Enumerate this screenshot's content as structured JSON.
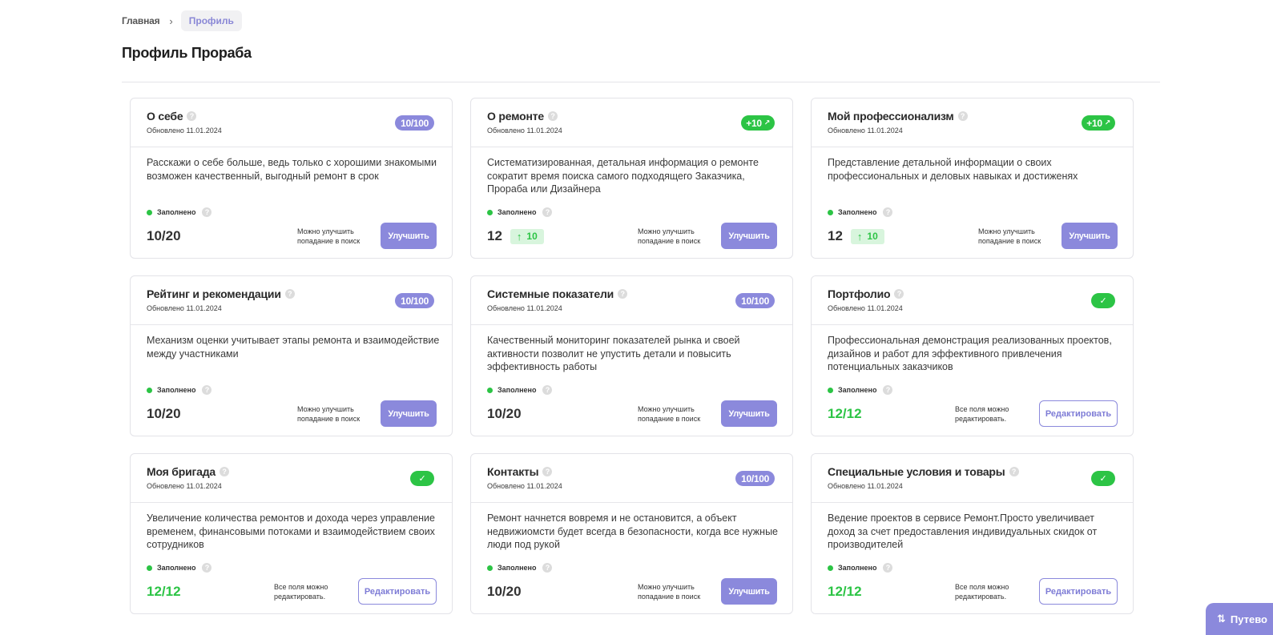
{
  "breadcrumb": {
    "home": "Главная",
    "separator": "›",
    "current": "Профиль"
  },
  "page": {
    "title": "Профиль Прораба"
  },
  "colors": {
    "accent": "#8b89dc",
    "success": "#2cc445",
    "success_bg": "#d8f5dd"
  },
  "cards": [
    {
      "title": "О себе",
      "updated": "Обновлено 11.01.2024",
      "badge": "10/100",
      "description": "Расскажи о себе больше, ведь только с хорошими знакомыми возможен качественный, выгодный ремонт в срок",
      "status": "Заполнено",
      "score": "10/20",
      "hint": "Можно улучшить попадание в поиск",
      "button": "Улучшить"
    },
    {
      "title": "О ремонте",
      "updated": "Обновлено 11.01.2024",
      "badge": "+10",
      "description": "Систематизированная, детальная информация о ремонте сократит время поиска самого подходящего Заказчика, Прораба или Дизайнера",
      "status": "Заполнено",
      "score": "12",
      "growth": "10",
      "hint": "Можно улучшить попадание в поиск",
      "button": "Улучшить"
    },
    {
      "title": "Мой профессионализм",
      "updated": "Обновлено 11.01.2024",
      "badge": "+10",
      "description": "Представление детальной информации о своих профессиональных и деловых навыках и достиженях",
      "status": "Заполнено",
      "score": "12",
      "growth": "10",
      "hint": "Можно улучшить попадание в поиск",
      "button": "Улучшить"
    },
    {
      "title": "Рейтинг и рекомендации",
      "updated": "Обновлено 11.01.2024",
      "badge": "10/100",
      "description": "Механизм оценки учитывает этапы ремонта и взаимодействие между участниками",
      "status": "Заполнено",
      "score": "10/20",
      "hint": "Можно улучшить попадание в поиск",
      "button": "Улучшить"
    },
    {
      "title": "Системные показатели",
      "updated": "Обновлено 11.01.2024",
      "badge": "10/100",
      "description": "Качественный мониторинг показателей рынка и своей активности позволит не упустить детали и повысить эффективность работы",
      "status": "Заполнено",
      "score": "10/20",
      "hint": "Можно улучшить попадание в поиск",
      "button": "Улучшить"
    },
    {
      "title": "Портфолио",
      "updated": "Обновлено 11.01.2024",
      "badge": "✓",
      "description": "Профессиональная демонстрация реализованных проектов, дизайнов и работ для эффективного привлечения потенциальных заказчиков",
      "status": "Заполнено",
      "score": "12/12",
      "hint": "Все поля можно редактировать.",
      "button": "Редактировать"
    },
    {
      "title": "Моя бригада",
      "updated": "Обновлено 11.01.2024",
      "badge": "✓",
      "description": "Увеличение количества ремонтов и дохода через управление временем, финансовыми потоками и взаимодействием своих сотрудников",
      "status": "Заполнено",
      "score": "12/12",
      "hint": "Все поля можно редактировать.",
      "button": "Редактировать"
    },
    {
      "title": "Контакты",
      "updated": "Обновлено 11.01.2024",
      "badge": "10/100",
      "description": "Ремонт начнется вовремя и не остановится, а объект недвижиомсти будет всегда в безопасности, когда все нужные люди под рукой",
      "status": "Заполнено",
      "score": "10/20",
      "hint": "Можно улучшить попадание в поиск",
      "button": "Улучшить"
    },
    {
      "title": "Специальные условия и товары",
      "updated": "Обновлено 11.01.2024",
      "badge": "✓",
      "description": "Ведение проектов в сервисе Ремонт.Просто увеличивает доход за счет предоставления индивидуальных скидок от производителей",
      "status": "Заполнено",
      "score": "12/12",
      "hint": "Все поля можно редактировать.",
      "button": "Редактировать"
    }
  ],
  "guide_button": "Путево"
}
